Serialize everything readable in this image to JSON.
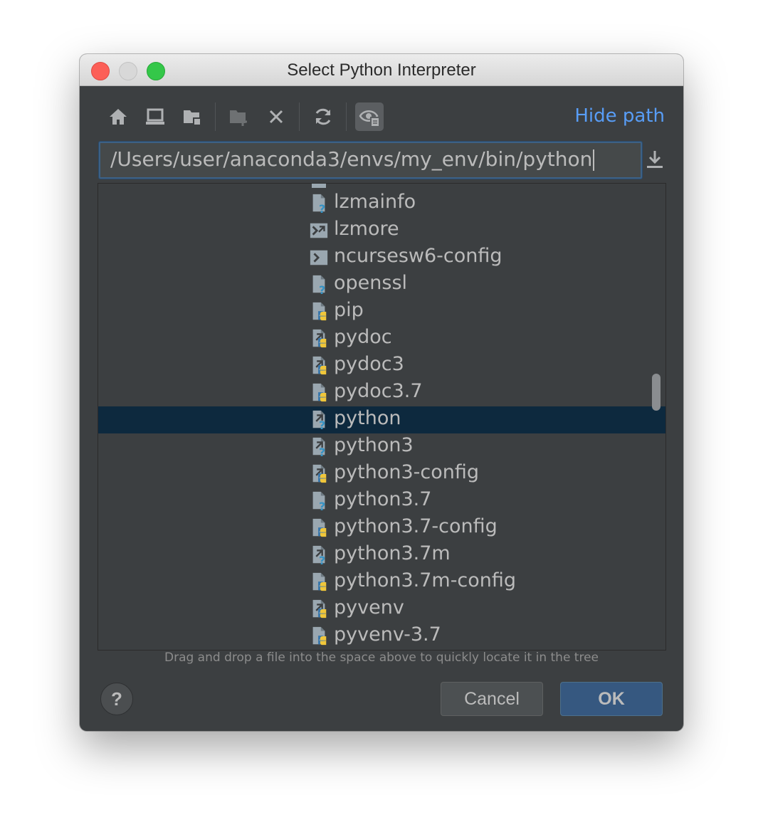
{
  "window": {
    "title": "Select Python Interpreter"
  },
  "toolbar": {
    "hide_path_label": "Hide path",
    "icons": [
      "home-icon",
      "desktop-icon",
      "project-folder-icon",
      "new-folder-icon",
      "delete-icon",
      "refresh-icon",
      "show-hidden-files-icon"
    ]
  },
  "path": {
    "value": "/Users/user/anaconda3/envs/my_env/bin/python"
  },
  "tree": {
    "items": [
      {
        "name": "lzmainfo",
        "icon": "unknown-file-icon",
        "selected": false
      },
      {
        "name": "lzmore",
        "icon": "symlink-script-icon",
        "selected": false
      },
      {
        "name": "ncursesw6-config",
        "icon": "script-icon",
        "selected": false
      },
      {
        "name": "openssl",
        "icon": "unknown-file-icon",
        "selected": false
      },
      {
        "name": "pip",
        "icon": "python-file-icon",
        "selected": false
      },
      {
        "name": "pydoc",
        "icon": "python-symlink-icon",
        "selected": false
      },
      {
        "name": "pydoc3",
        "icon": "python-symlink-icon",
        "selected": false
      },
      {
        "name": "pydoc3.7",
        "icon": "python-file-icon",
        "selected": false
      },
      {
        "name": "python",
        "icon": "unknown-symlink-icon",
        "selected": true
      },
      {
        "name": "python3",
        "icon": "unknown-symlink-icon",
        "selected": false
      },
      {
        "name": "python3-config",
        "icon": "python-symlink-icon",
        "selected": false
      },
      {
        "name": "python3.7",
        "icon": "unknown-file-icon",
        "selected": false
      },
      {
        "name": "python3.7-config",
        "icon": "python-file-icon",
        "selected": false
      },
      {
        "name": "python3.7m",
        "icon": "unknown-symlink-icon",
        "selected": false
      },
      {
        "name": "python3.7m-config",
        "icon": "python-file-icon",
        "selected": false
      },
      {
        "name": "pyvenv",
        "icon": "python-symlink-icon",
        "selected": false
      },
      {
        "name": "pyvenv-3.7",
        "icon": "python-file-icon",
        "selected": false
      }
    ]
  },
  "hint": "Drag and drop a file into the space above to quickly locate it in the tree",
  "buttons": {
    "help": "?",
    "cancel": "Cancel",
    "ok": "OK"
  },
  "colors": {
    "background": "#3c3f41",
    "selection": "#0d293e",
    "accent": "#589df6",
    "ok_button": "#365880"
  }
}
